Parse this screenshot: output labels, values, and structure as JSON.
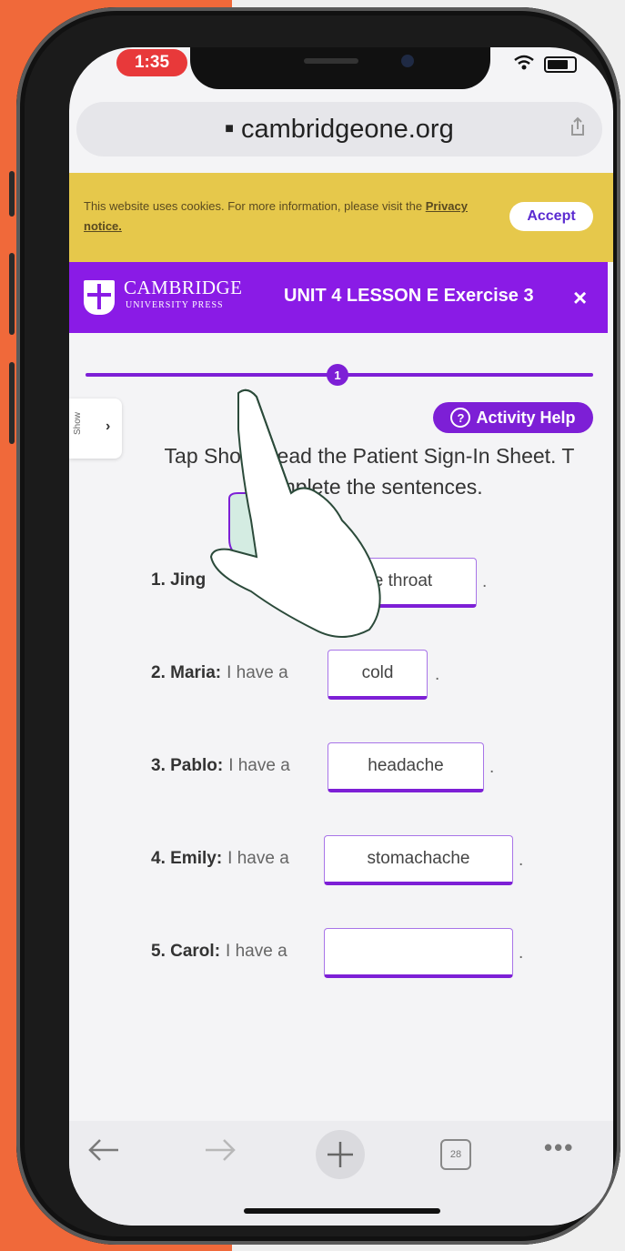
{
  "status_bar": {
    "time": "1:35"
  },
  "browser": {
    "url": "cambridgeone.org",
    "tab_count": "28"
  },
  "cookie_banner": {
    "text": "This website uses cookies. For more information, please visit the",
    "link": "Privacy notice.",
    "accept_label": "Accept"
  },
  "header": {
    "brand_main": "CAMBRIDGE",
    "brand_sub": "UNIVERSITY PRESS",
    "lesson_title": "UNIT 4 LESSON E Exercise 3",
    "close_symbol": "×"
  },
  "progress": {
    "current_step": "1"
  },
  "show_tab": {
    "label": "Show",
    "chevron": "›"
  },
  "activity_help": {
    "label": "Activity Help"
  },
  "instructions": "Tap Sho  to read the Patient Sign-In Sheet. T    complete the sentences.",
  "sentences": [
    {
      "number_name": "1. Jing",
      "phrase": "",
      "answer": "e throat"
    },
    {
      "number_name": "2. Maria:",
      "phrase": "I have a",
      "answer": "cold"
    },
    {
      "number_name": "3. Pablo:",
      "phrase": "I have a",
      "answer": "headache"
    },
    {
      "number_name": "4. Emily:",
      "phrase": "I have a",
      "answer": "stomachache"
    },
    {
      "number_name": "5. Carol:",
      "phrase": "I have a",
      "answer": ""
    }
  ],
  "period": ".",
  "icons": {
    "back": "back-arrow-icon",
    "forward": "forward-arrow-icon",
    "new_tab": "plus-icon",
    "tabs": "tabs-icon",
    "more": "more-icon",
    "share": "share-icon",
    "lock": "lock-icon",
    "wifi": "wifi-icon",
    "battery": "battery-icon",
    "hand": "pointing-hand-icon"
  },
  "colors": {
    "accent": "#7d1fd6",
    "banner": "#e6c84b",
    "orange_bg": "#f0693a",
    "time_pill": "#e8393a"
  }
}
